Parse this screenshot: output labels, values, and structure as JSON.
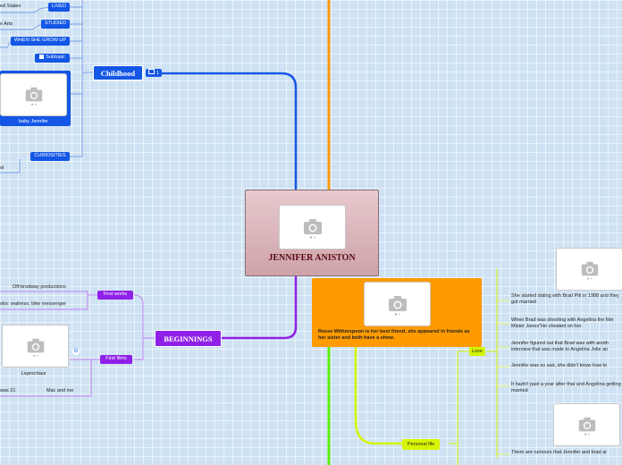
{
  "central": {
    "title": "JENNIFER ANISTON",
    "image": "photo-placeholder-icon"
  },
  "childhood": {
    "label": "Childhood",
    "badge": "1",
    "items": {
      "lived": "LIVED",
      "lived_detail": "ed States",
      "studied": "STUDIED",
      "studied_detail": "e Arts",
      "grow_up": "WHEN SHE GROW UP",
      "subtopic": "Subtopic",
      "baby_caption": "baby Jennifer",
      "curiosities": "CURIOSITIES",
      "curiosities_detail": "ol"
    }
  },
  "beginnings": {
    "label": "BEGINNINGS",
    "first_works": "First works",
    "first_works_items": [
      "Off-brodway productions",
      "obs: waitress, bike messenger"
    ],
    "first_films": "First films",
    "film_caption": "Leprechaur",
    "film_items": [
      "was 21",
      "Mac and me"
    ]
  },
  "relationships": {
    "note": "Reese Witherspoon is her best friend, she appeared in friends as her sister and both have a show.",
    "personal_life": "Personal life",
    "love": "Love",
    "love_items": [
      "She started dating with Brad Pitt in 1988 and they got married",
      "When Brad was shooting with Angelina the film Mister Jones\"He cheated on her.",
      "Jennifer figured out that Brad was with anoth interview that was made to Angelina Jolie an",
      "Jennifer was so sad, she didn't know how to",
      "It hadn't past a year after that and Angelina getting married",
      "There are rumours that Jennifer and brad ar"
    ]
  },
  "colors": {
    "blue": "#1457e6",
    "purple": "#9020e8",
    "orange": "#ff9a00",
    "green": "#5cf000",
    "yellow": "#d6f500"
  }
}
